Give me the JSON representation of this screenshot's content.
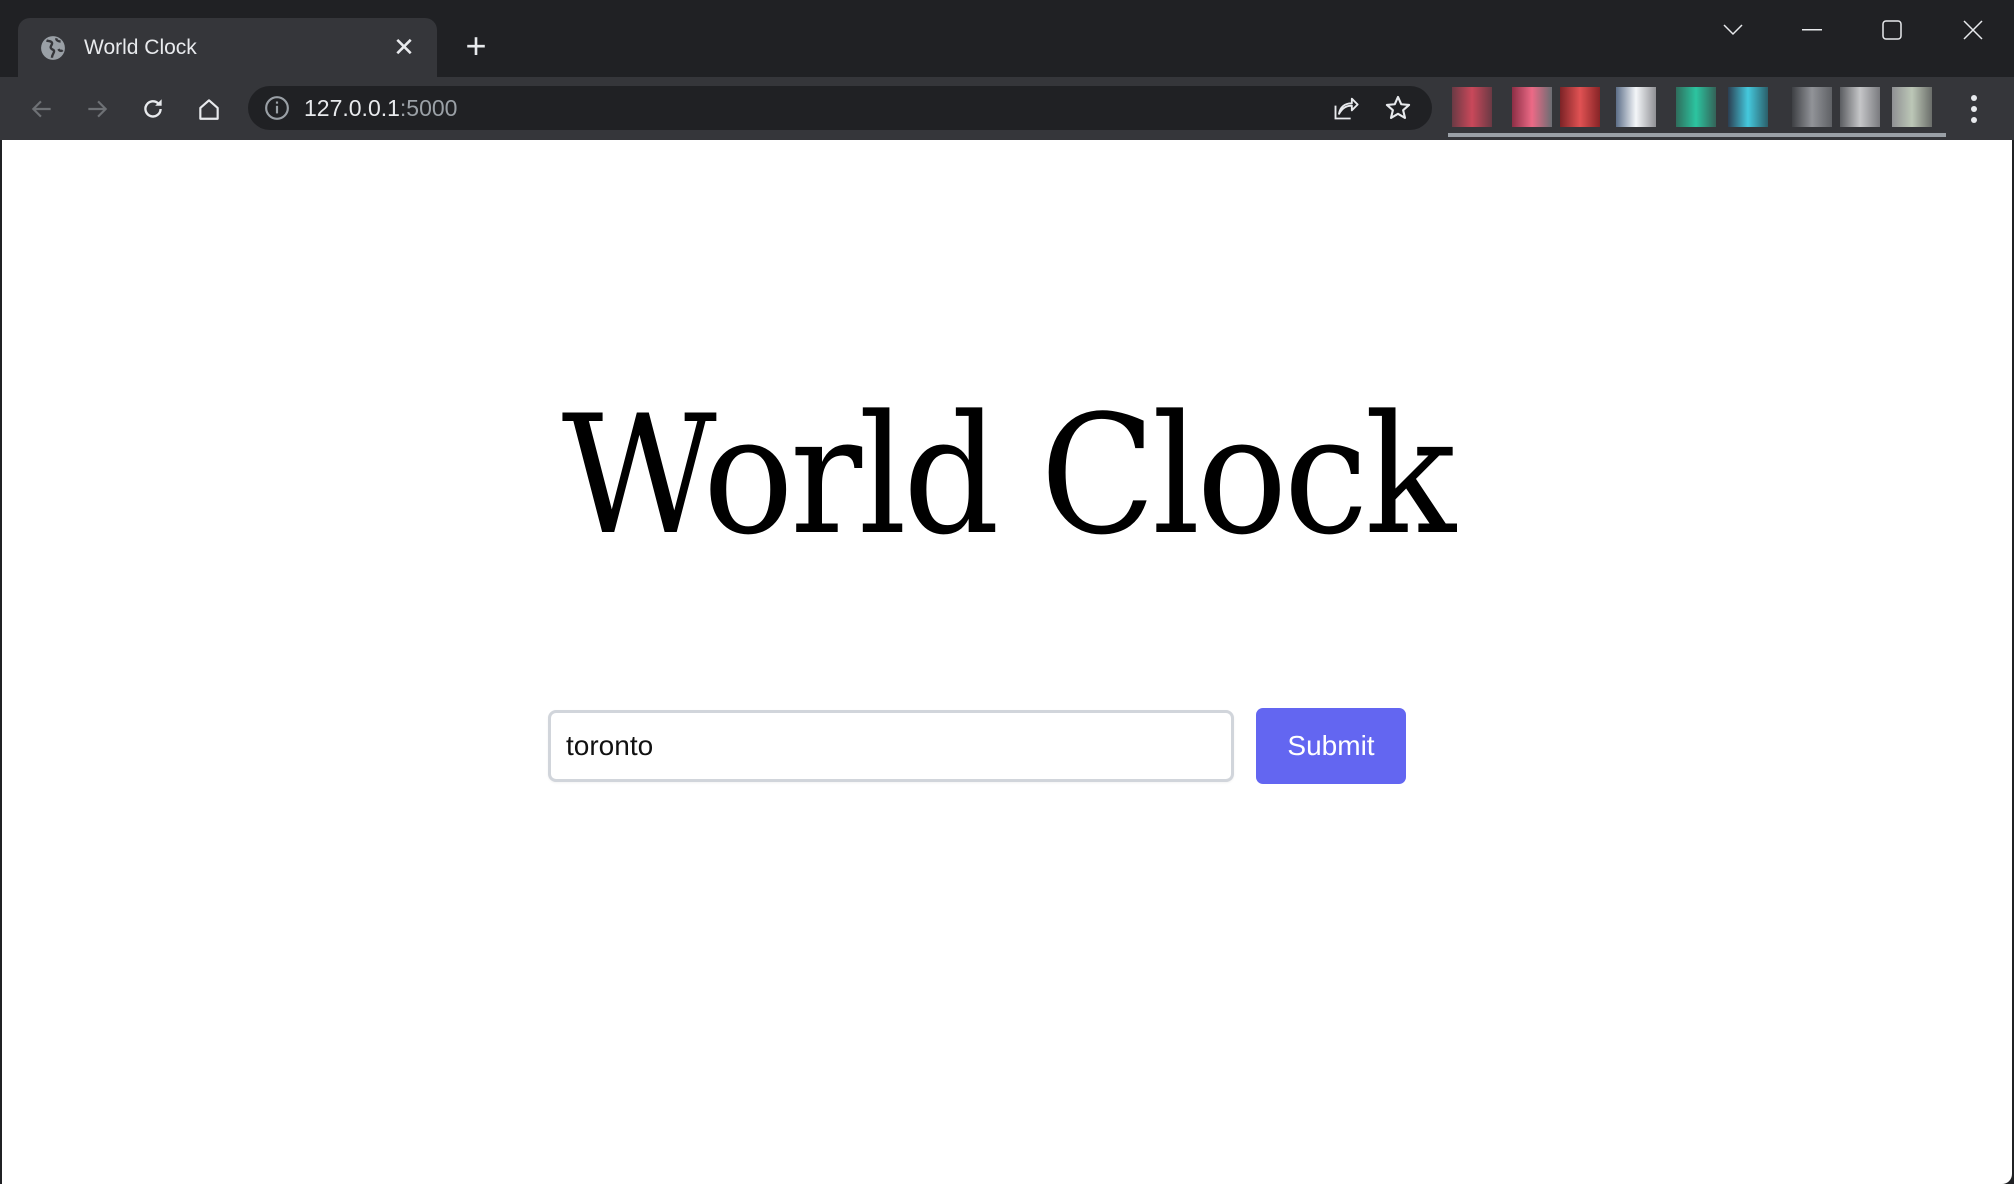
{
  "browser": {
    "tab": {
      "title": "World Clock",
      "favicon": "globe-icon",
      "close": "✕"
    },
    "new_tab": "+",
    "window_controls": [
      "tab-search",
      "minimize",
      "maximize",
      "close"
    ],
    "address": {
      "host": "127.0.0.1",
      "port": ":5000",
      "security_icon": "info-icon"
    },
    "extensions_count": 9,
    "colors": {
      "frame": "#202124",
      "toolbar": "#35363a"
    }
  },
  "page": {
    "heading": "World Clock",
    "form": {
      "input_value": "toronto",
      "submit_label": "Submit"
    },
    "colors": {
      "accent": "#6366f1"
    }
  }
}
